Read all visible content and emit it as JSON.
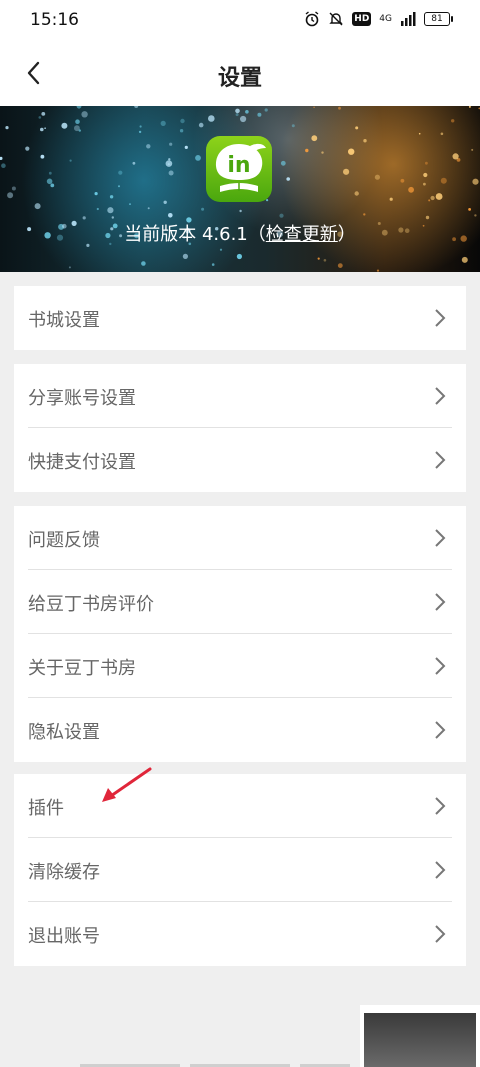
{
  "status_bar": {
    "time": "15:16",
    "hd": "HD",
    "signal": "4G",
    "battery": "81"
  },
  "header": {
    "title": "设置",
    "back_icon": "chevron-left-icon"
  },
  "banner": {
    "app_icon_text": "in",
    "version_prefix": "当前版本 4.6.1（",
    "check_update": "检查更新",
    "version_suffix": "）"
  },
  "groups": [
    {
      "items": [
        {
          "label": "书城设置"
        }
      ]
    },
    {
      "items": [
        {
          "label": "分享账号设置"
        },
        {
          "label": "快捷支付设置"
        }
      ]
    },
    {
      "items": [
        {
          "label": "问题反馈"
        },
        {
          "label": "给豆丁书房评价"
        },
        {
          "label": "关于豆丁书房"
        },
        {
          "label": "隐私设置"
        }
      ]
    },
    {
      "items": [
        {
          "label": "插件"
        },
        {
          "label": "清除缓存"
        },
        {
          "label": "退出账号"
        }
      ]
    }
  ],
  "colors": {
    "accent_arrow": "#e0263a",
    "app_icon_green": "#6cc214"
  }
}
